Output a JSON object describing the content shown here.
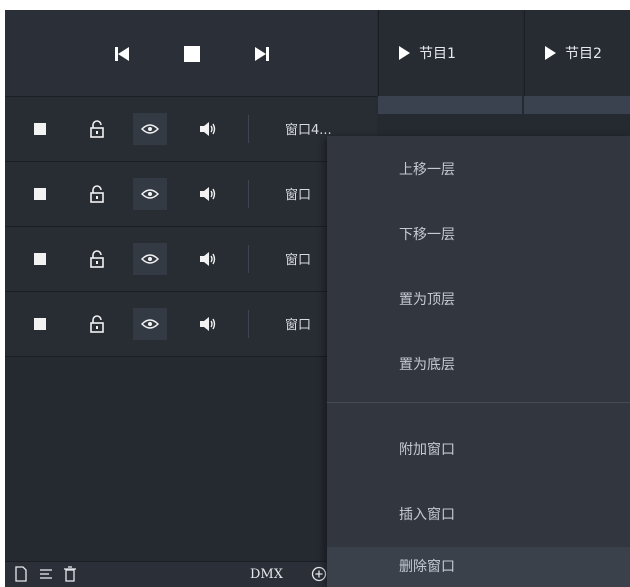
{
  "transport": {
    "prev_icon": "skip-previous-icon",
    "stop_icon": "stop-icon",
    "next_icon": "skip-next-icon"
  },
  "programs": [
    {
      "label": "节目1"
    },
    {
      "label": "节目2"
    }
  ],
  "layers": [
    {
      "name": "窗口4..."
    },
    {
      "name": "窗口"
    },
    {
      "name": "窗口"
    },
    {
      "name": "窗口"
    }
  ],
  "bottom_bar": {
    "dmx_label": "DMX",
    "icons": [
      "new-file-icon",
      "list-icon",
      "trash-icon",
      "add-circle-icon"
    ]
  },
  "context_menu": {
    "items": [
      {
        "label": "上移一层"
      },
      {
        "label": "下移一层"
      },
      {
        "label": "置为顶层"
      },
      {
        "label": "置为底层"
      },
      {
        "label": "附加窗口"
      },
      {
        "label": "插入窗口"
      },
      {
        "label": "删除窗口"
      }
    ],
    "hovered_index": 6
  },
  "colors": {
    "background": "#252a31",
    "menu_background": "#31363f",
    "menu_hover": "#3b414b",
    "text": "#e6e9ee"
  }
}
